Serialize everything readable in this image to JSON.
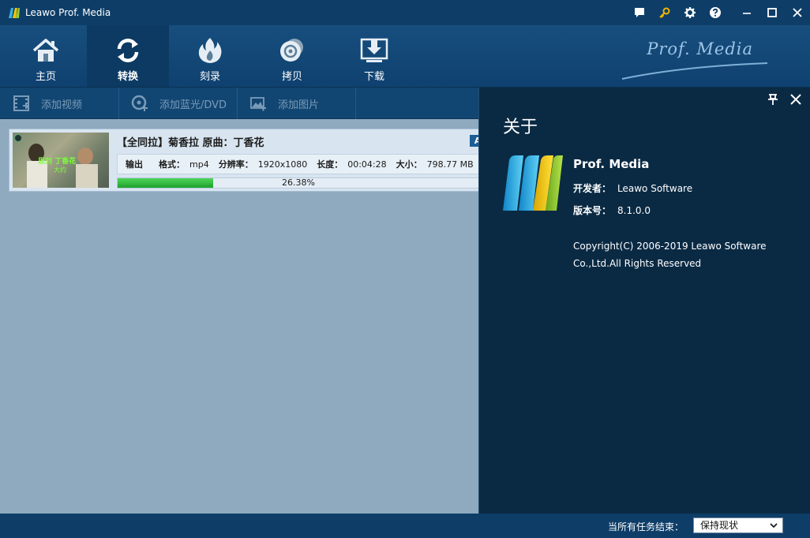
{
  "window": {
    "title": "Leawo Prof. Media"
  },
  "title_icons": [
    "chat-icon",
    "key-icon",
    "gear-icon",
    "help-icon",
    "minimize-icon",
    "maximize-icon",
    "close-icon"
  ],
  "main_tabs": [
    {
      "label": "主页",
      "icon": "home-icon",
      "active": false
    },
    {
      "label": "转换",
      "icon": "convert-icon",
      "active": true
    },
    {
      "label": "刻录",
      "icon": "burn-icon",
      "active": false
    },
    {
      "label": "拷贝",
      "icon": "copy-disc-icon",
      "active": false
    },
    {
      "label": "下载",
      "icon": "download-icon",
      "active": false
    }
  ],
  "brand": "Prof. Media",
  "sub_toolbar": [
    {
      "label": "添加视频",
      "icon": "film-icon"
    },
    {
      "label": "添加蓝光/DVD",
      "icon": "disc-add-icon"
    },
    {
      "label": "添加图片",
      "icon": "image-icon"
    }
  ],
  "item": {
    "title": "【全同拉】菊香拉 原曲：丁香花",
    "tag": "A",
    "output_label": "输出",
    "format_label": "格式：",
    "format": "mp4",
    "resolution_label": "分辨率：",
    "resolution": "1920x1080",
    "duration_label": "长度：",
    "duration": "00:04:28",
    "size_label": "大小：",
    "size": "798.77 MB",
    "progress_text": "26.38%",
    "progress": 0.2638,
    "thumb_caption": "思刘 丁香花",
    "thumb_caption2": "大约"
  },
  "about": {
    "title": "关于",
    "product": "Prof. Media",
    "developer_label": "开发者：",
    "developer": "Leawo Software",
    "version_label": "版本号：",
    "version": "8.1.0.0",
    "copyright_line1": "Copyright(C)  2006-2019  Leawo Software",
    "copyright_line2": "Co.,Ltd.All Rights Reserved"
  },
  "status": {
    "label": "当所有任务结束：",
    "select_value": "保持现状"
  },
  "colors": {
    "titlebar": "#0e3e68",
    "about_bg": "#0a2a44",
    "content_bg": "#8fa9bf",
    "progress_green": "#1ea22d",
    "key_icon": "#f0b400"
  }
}
